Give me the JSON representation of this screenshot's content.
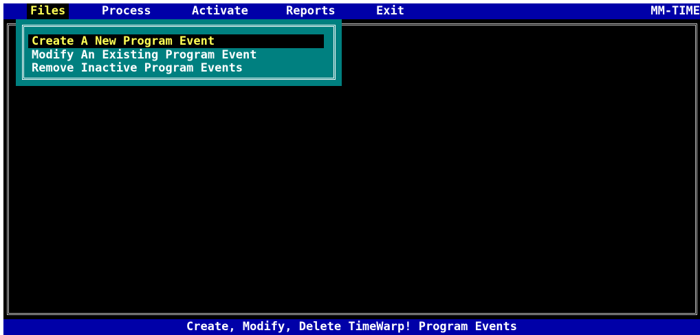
{
  "menubar": {
    "items": [
      {
        "label": "Files",
        "active": true
      },
      {
        "label": "Process",
        "active": false
      },
      {
        "label": "Activate",
        "active": false
      },
      {
        "label": "Reports",
        "active": false
      },
      {
        "label": "Exit",
        "active": false
      }
    ],
    "app_name": "MM-TIME"
  },
  "dropdown": {
    "items": [
      {
        "label": "Create A New Program Event",
        "selected": true
      },
      {
        "label": "Modify An Existing Program Event",
        "selected": false
      },
      {
        "label": "Remove Inactive Program Events",
        "selected": false
      }
    ]
  },
  "status": {
    "text": "Create, Modify, Delete TimeWarp! Program Events"
  },
  "colors": {
    "menubar_bg": "#0000a8",
    "highlight_text": "#ffff55",
    "dropdown_bg": "#008080",
    "screen_bg": "#000000"
  }
}
